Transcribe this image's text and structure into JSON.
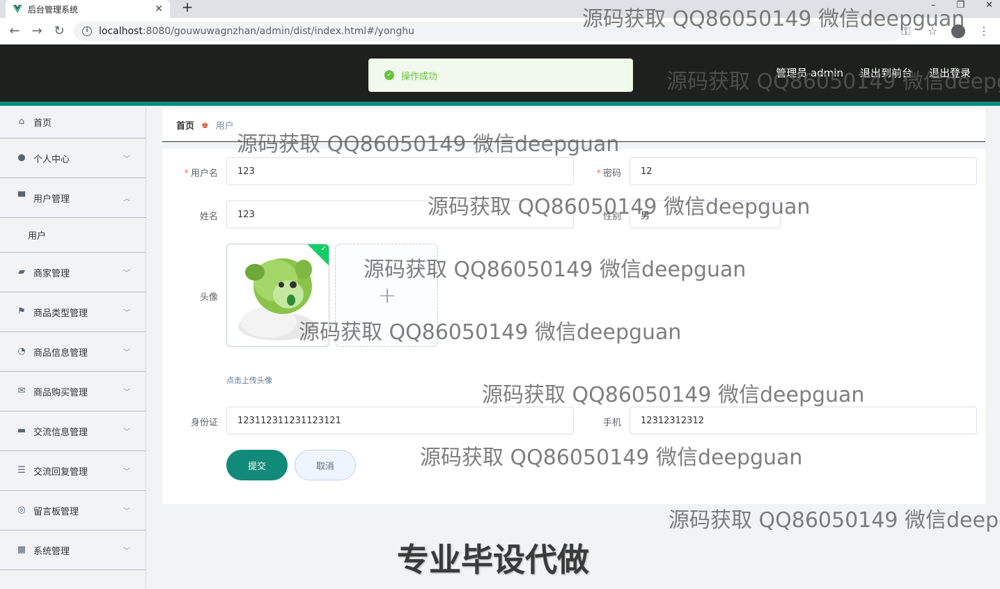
{
  "browser": {
    "tab_title": "后台管理系统",
    "tab_close": "✕",
    "new_tab": "+",
    "win_min": "–",
    "win_restore": "❐",
    "win_close": "✕",
    "url_host": "localhost",
    "url_path": ":8080/gouwuwagnzhan/admin/dist/index.html#/yonghu",
    "back": "←",
    "forward": "→",
    "reload": "↻"
  },
  "header": {
    "admin_label": "管理员 admin",
    "front_label": "退出到前台",
    "logout_label": "退出登录"
  },
  "toast": {
    "text": "操作成功"
  },
  "sidebar": {
    "items": [
      {
        "label": "首页",
        "icon": "home-icon"
      },
      {
        "label": "个人中心",
        "icon": "user-icon"
      },
      {
        "label": "用户管理",
        "icon": "user-manage-icon"
      },
      {
        "label": "用户"
      },
      {
        "label": "商家管理",
        "icon": "shop-icon"
      },
      {
        "label": "商品类型管理",
        "icon": "flag-icon"
      },
      {
        "label": "商品信息管理",
        "icon": "gauge-icon"
      },
      {
        "label": "商品购买管理",
        "icon": "mail-icon"
      },
      {
        "label": "交流信息管理",
        "icon": "chat-icon"
      },
      {
        "label": "交流回复管理",
        "icon": "sliders-icon"
      },
      {
        "label": "留言板管理",
        "icon": "target-icon"
      },
      {
        "label": "系统管理",
        "icon": "grid-icon"
      }
    ]
  },
  "breadcrumb": {
    "home": "首页",
    "current": "用户"
  },
  "form": {
    "username_label": "用户名",
    "username_value": "123",
    "password_label": "密码",
    "password_value": "12",
    "name_label": "姓名",
    "name_value": "123",
    "gender_label": "性别",
    "gender_value": "男",
    "avatar_label": "头像",
    "upload_plus": "+",
    "upload_tip": "点击上传头像",
    "idcard_label": "身份证",
    "idcard_value": "123112311231123121",
    "phone_label": "手机",
    "phone_value": "12312312312",
    "submit_label": "提交",
    "cancel_label": "取消"
  },
  "watermark": {
    "text": "源码获取 QQ86050149 微信deepguan",
    "big_text": "专业毕设代做"
  },
  "colors": {
    "accent": "#128a7a",
    "header_bg": "#1e201e",
    "success": "#67c23a"
  }
}
